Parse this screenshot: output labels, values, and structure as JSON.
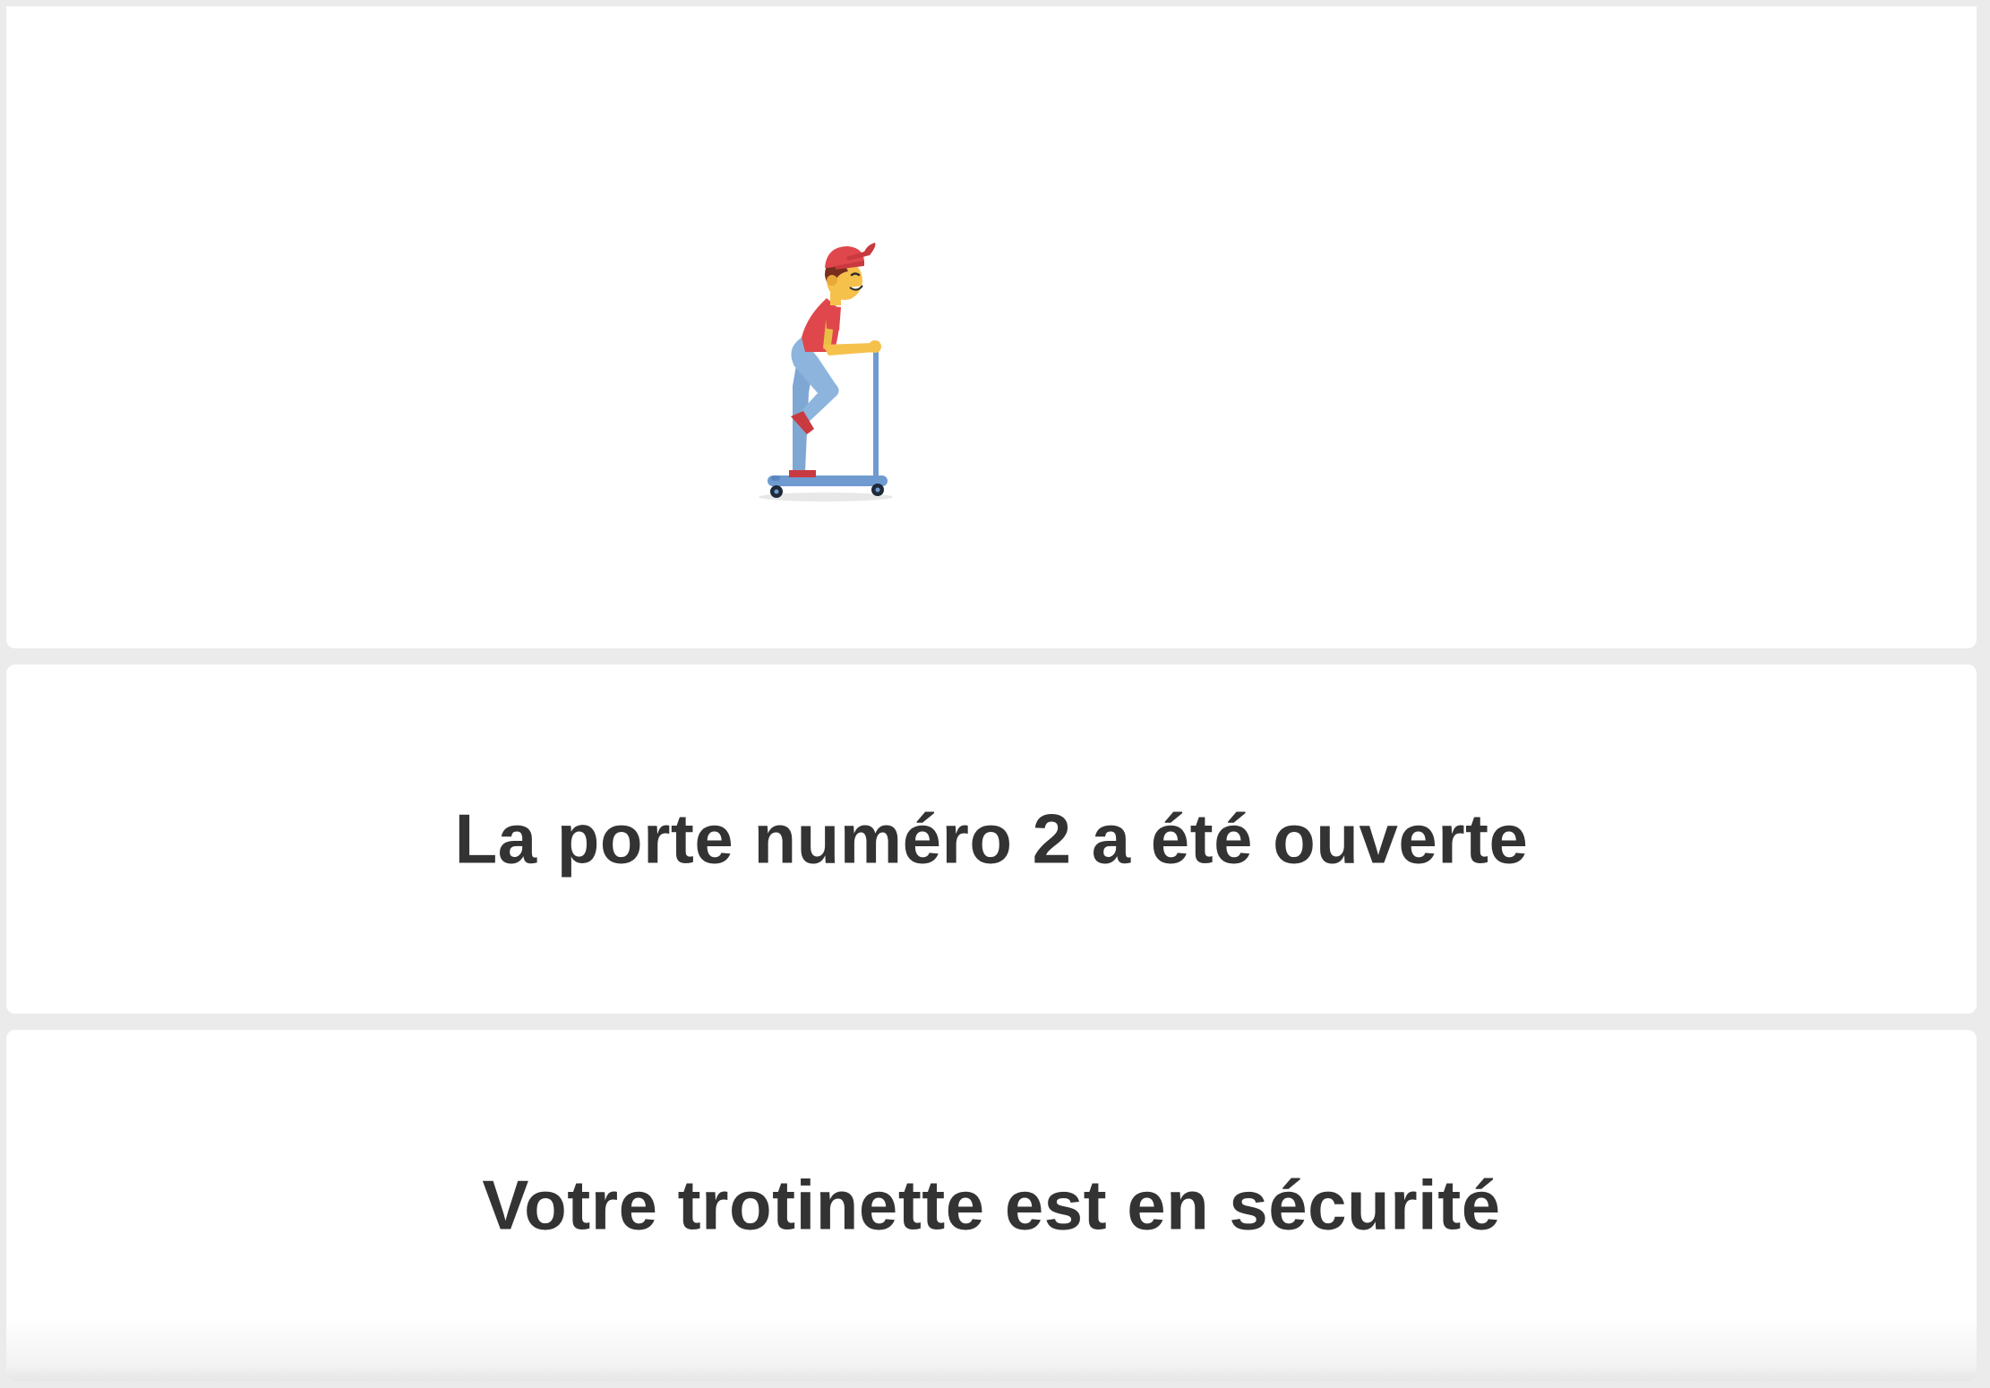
{
  "illustration": {
    "icon": "kid-on-scooter-icon",
    "colors": {
      "cap": "#e0474c",
      "shirt": "#e0474c",
      "skin": "#f6c14b",
      "hair": "#7a2e1d",
      "pants": "#8db4dc",
      "scooter": "#6f9bd1"
    }
  },
  "messages": {
    "door_opened": "La porte numéro 2 a été ouverte",
    "scooter_secure": "Votre trotinette est en sécurité"
  },
  "theme": {
    "background": "#ebebeb",
    "card": "#ffffff",
    "text": "#333333"
  }
}
